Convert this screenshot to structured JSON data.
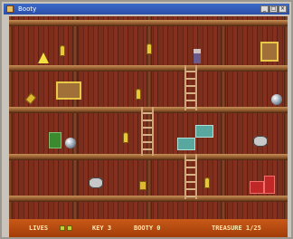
{
  "window": {
    "title": "Booty",
    "buttons": {
      "minimize": "_",
      "maximize": "□",
      "close": "×"
    }
  },
  "game": {
    "scene": "treasure-ship-hold",
    "items": [
      {
        "name": "cone-icon",
        "kind": "cone"
      },
      {
        "name": "key-icon",
        "kind": "key"
      },
      {
        "name": "key-icon",
        "kind": "key"
      },
      {
        "name": "player-figure-icon",
        "kind": "figure"
      },
      {
        "name": "chest-icon",
        "kind": "chest"
      },
      {
        "name": "sword-icon",
        "kind": "gold-bar"
      },
      {
        "name": "treasure-chest-icon",
        "kind": "chest"
      },
      {
        "name": "orb-icon",
        "kind": "orb"
      },
      {
        "name": "key-icon",
        "kind": "key"
      },
      {
        "name": "green-box-icon",
        "kind": "green-box"
      },
      {
        "name": "key-icon",
        "kind": "key"
      },
      {
        "name": "block-icon",
        "kind": "block"
      },
      {
        "name": "orb-icon",
        "kind": "orb"
      },
      {
        "name": "creature-icon",
        "kind": "creature"
      },
      {
        "name": "gold-bar-icon",
        "kind": "gold-bar"
      },
      {
        "name": "key-icon",
        "kind": "key"
      },
      {
        "name": "red-box-icon",
        "kind": "red-box"
      }
    ]
  },
  "status": {
    "lives_label": "LIVES",
    "key_label": "KEY 3",
    "booty_label": "BOOTY 0",
    "treasure_label": "TREASURE 1/25"
  },
  "colors": {
    "wood": "#7a2e1c",
    "shelf": "#c89058",
    "status_bar": "#c85a18",
    "status_text": "#f8e8b0",
    "title_bar": "#2a4ea8"
  }
}
